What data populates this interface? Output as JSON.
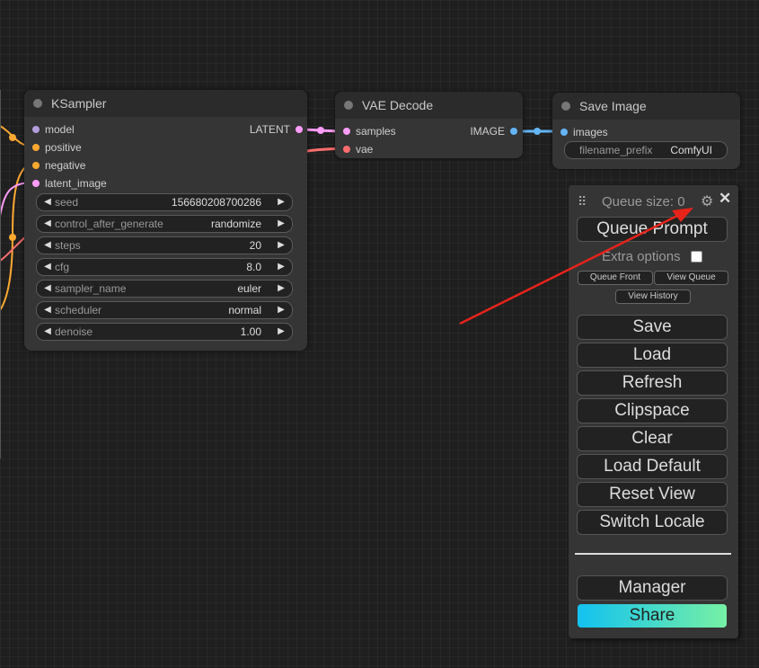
{
  "ksampler": {
    "title": "KSampler",
    "inputs": [
      "model",
      "positive",
      "negative",
      "latent_image"
    ],
    "output": "LATENT",
    "widgets": [
      {
        "name": "seed",
        "value": "156680208700286"
      },
      {
        "name": "control_after_generate",
        "value": "randomize"
      },
      {
        "name": "steps",
        "value": "20"
      },
      {
        "name": "cfg",
        "value": "8.0"
      },
      {
        "name": "sampler_name",
        "value": "euler"
      },
      {
        "name": "scheduler",
        "value": "normal"
      },
      {
        "name": "denoise",
        "value": "1.00"
      }
    ]
  },
  "vae_decode": {
    "title": "VAE Decode",
    "inputs": [
      "samples",
      "vae"
    ],
    "output": "IMAGE"
  },
  "save_image": {
    "title": "Save Image",
    "input": "images",
    "widget": {
      "name": "filename_prefix",
      "value": "ComfyUI"
    }
  },
  "menu": {
    "drag_handle": "⠿",
    "queue_size": "Queue size: 0",
    "settings_icon": "⚙",
    "close_icon": "✕",
    "queue_prompt": "Queue Prompt",
    "extra_options": "Extra options",
    "queue_front": "Queue Front",
    "view_queue": "View Queue",
    "view_history": "View History",
    "buttons": [
      "Save",
      "Load",
      "Refresh",
      "Clipspace",
      "Clear",
      "Load Default",
      "Reset View",
      "Switch Locale"
    ],
    "manager": "Manager",
    "share": "Share"
  },
  "colors": {
    "model": "#b39ddb",
    "positive": "#ffa931",
    "negative": "#ffa931",
    "latent": "#ff9cf9",
    "vae": "#ff6e6e",
    "image": "#64b5f6",
    "annotation_arrow": "#e8231a"
  }
}
